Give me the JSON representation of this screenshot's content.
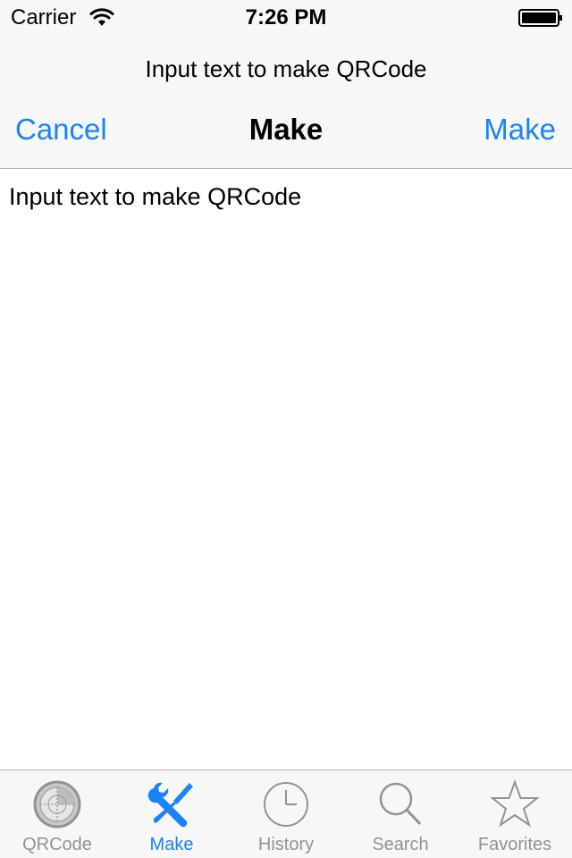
{
  "status_bar": {
    "carrier": "Carrier",
    "time": "7:26 PM"
  },
  "nav": {
    "prompt": "Input text to make QRCode",
    "cancel_label": "Cancel",
    "title": "Make",
    "make_label": "Make"
  },
  "editor": {
    "placeholder": "Input text to make QRCode"
  },
  "tab_bar": {
    "active_color": "#1a82fb",
    "inactive_color": "#929292",
    "tabs": [
      {
        "label": "QRCode",
        "icon": "radar-icon"
      },
      {
        "label": "Make",
        "icon": "tools-icon"
      },
      {
        "label": "History",
        "icon": "clock-icon"
      },
      {
        "label": "Search",
        "icon": "magnifier-icon"
      },
      {
        "label": "Favorites",
        "icon": "star-icon"
      }
    ],
    "selected": "Make"
  }
}
